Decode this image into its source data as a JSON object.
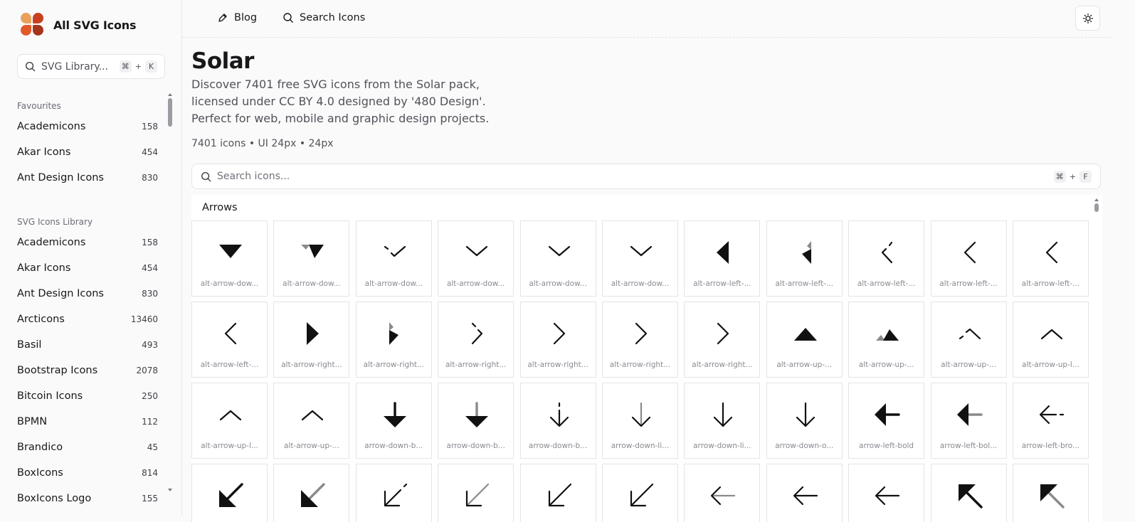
{
  "app": {
    "name": "All SVG Icons"
  },
  "sidebar": {
    "search": {
      "placeholder": "SVG Library...",
      "shortcut_mod": "⌘",
      "shortcut_plus": "+",
      "shortcut_key": "K"
    },
    "favourites_title": "Favourites",
    "favourites": [
      {
        "label": "Academicons",
        "count": "158"
      },
      {
        "label": "Akar Icons",
        "count": "454"
      },
      {
        "label": "Ant Design Icons",
        "count": "830"
      }
    ],
    "library_title": "SVG Icons Library",
    "library": [
      {
        "label": "Academicons",
        "count": "158"
      },
      {
        "label": "Akar Icons",
        "count": "454"
      },
      {
        "label": "Ant Design Icons",
        "count": "830"
      },
      {
        "label": "Arcticons",
        "count": "13460"
      },
      {
        "label": "Basil",
        "count": "493"
      },
      {
        "label": "Bootstrap Icons",
        "count": "2078"
      },
      {
        "label": "Bitcoin Icons",
        "count": "250"
      },
      {
        "label": "BPMN",
        "count": "112"
      },
      {
        "label": "Brandico",
        "count": "45"
      },
      {
        "label": "BoxIcons",
        "count": "814"
      },
      {
        "label": "BoxIcons Logo",
        "count": "155"
      }
    ]
  },
  "topbar": {
    "blog": "Blog",
    "search_icons": "Search Icons"
  },
  "main": {
    "title": "Solar",
    "description": "Discover 7401 free SVG icons from the Solar pack, licensed under CC BY 4.0 designed by '480 Design'. Perfect for web, mobile and graphic design projects.",
    "meta": "7401 icons • UI 24px • 24px",
    "search": {
      "placeholder": "Search icons...",
      "shortcut_mod": "⌘",
      "shortcut_plus": "+",
      "shortcut_key": "F"
    },
    "category": "Arrows",
    "icons": [
      {
        "label": "alt-arrow-dow...",
        "icon": "tri-down-bold"
      },
      {
        "label": "alt-arrow-dow...",
        "icon": "tri-down-duotone"
      },
      {
        "label": "alt-arrow-dow...",
        "icon": "chev-down-broken"
      },
      {
        "label": "alt-arrow-dow...",
        "icon": "chev-down"
      },
      {
        "label": "alt-arrow-dow...",
        "icon": "chev-down"
      },
      {
        "label": "alt-arrow-dow...",
        "icon": "chev-down"
      },
      {
        "label": "alt-arrow-left-...",
        "icon": "tri-left-bold"
      },
      {
        "label": "alt-arrow-left-...",
        "icon": "tri-left-duotone"
      },
      {
        "label": "alt-arrow-left-...",
        "icon": "chev-left-broken"
      },
      {
        "label": "alt-arrow-left-...",
        "icon": "chev-left"
      },
      {
        "label": "alt-arrow-left-...",
        "icon": "chev-left"
      },
      {
        "label": "alt-arrow-left-...",
        "icon": "chev-left"
      },
      {
        "label": "alt-arrow-right...",
        "icon": "tri-right-bold"
      },
      {
        "label": "alt-arrow-right...",
        "icon": "tri-right-duotone"
      },
      {
        "label": "alt-arrow-right...",
        "icon": "chev-right-broken"
      },
      {
        "label": "alt-arrow-right...",
        "icon": "chev-right"
      },
      {
        "label": "alt-arrow-right...",
        "icon": "chev-right"
      },
      {
        "label": "alt-arrow-right...",
        "icon": "chev-right"
      },
      {
        "label": "alt-arrow-up-...",
        "icon": "tri-up-bold"
      },
      {
        "label": "alt-arrow-up-...",
        "icon": "tri-up-duotone"
      },
      {
        "label": "alt-arrow-up-...",
        "icon": "chev-up-broken"
      },
      {
        "label": "alt-arrow-up-l...",
        "icon": "chev-up"
      },
      {
        "label": "alt-arrow-up-l...",
        "icon": "chev-up"
      },
      {
        "label": "alt-arrow-up-...",
        "icon": "chev-up"
      },
      {
        "label": "arrow-down-b...",
        "icon": "arrow-down-bold"
      },
      {
        "label": "arrow-down-b...",
        "icon": "arrow-down-bold-duotone"
      },
      {
        "label": "arrow-down-b...",
        "icon": "arrow-down-broken"
      },
      {
        "label": "arrow-down-li...",
        "icon": "arrow-down-line-duotone"
      },
      {
        "label": "arrow-down-li...",
        "icon": "arrow-down-line"
      },
      {
        "label": "arrow-down-o...",
        "icon": "arrow-down-line"
      },
      {
        "label": "arrow-left-bold",
        "icon": "arrow-left-bold"
      },
      {
        "label": "arrow-left-bol...",
        "icon": "arrow-left-bold-duotone"
      },
      {
        "label": "arrow-left-bro...",
        "icon": "arrow-left-broken"
      },
      {
        "label": "",
        "icon": "arrow-dl-bold"
      },
      {
        "label": "",
        "icon": "arrow-dl-bold-duotone"
      },
      {
        "label": "",
        "icon": "arrow-dl-broken"
      },
      {
        "label": "",
        "icon": "arrow-dl-line-duotone"
      },
      {
        "label": "",
        "icon": "arrow-dl-line"
      },
      {
        "label": "",
        "icon": "arrow-dl-line"
      },
      {
        "label": "",
        "icon": "arrow-left-line-duotone"
      },
      {
        "label": "",
        "icon": "arrow-left-line"
      },
      {
        "label": "",
        "icon": "arrow-left-line"
      },
      {
        "label": "",
        "icon": "arrow-ul-bold"
      },
      {
        "label": "",
        "icon": "arrow-ul-bold-duotone"
      }
    ]
  },
  "colors": {
    "logo": [
      "#e8a15a",
      "#c8401f",
      "#e15a2a",
      "#a6341c"
    ],
    "icon": "#111111",
    "icon_secondary": "#8a8a8a"
  }
}
